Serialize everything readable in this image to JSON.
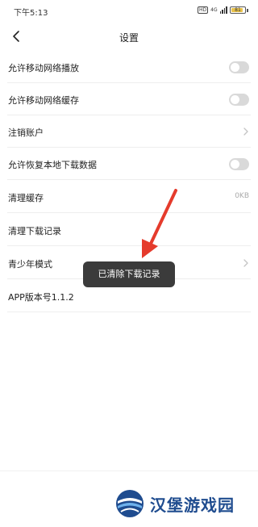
{
  "status_bar": {
    "time": "下午5:13",
    "hd": "HD",
    "network": "4G",
    "battery": "81",
    "battery_color": "#e9c24a"
  },
  "header": {
    "title": "设置",
    "back_icon": "chevron-left-icon"
  },
  "settings": {
    "allow_mobile_play": {
      "label": "允许移动网络播放",
      "enabled": false
    },
    "allow_mobile_cache": {
      "label": "允许移动网络缓存",
      "enabled": false
    },
    "cancel_account": {
      "label": "注销账户"
    },
    "allow_restore_local": {
      "label": "允许恢复本地下载数据",
      "enabled": false
    },
    "clear_cache": {
      "label": "清理缓存",
      "value": "0KB"
    },
    "clear_download_records": {
      "label": "清理下载记录"
    },
    "teen_mode": {
      "label": "青少年模式"
    },
    "app_version": {
      "label": "APP版本号1.1.2"
    }
  },
  "toast": {
    "text": "已清除下载记录"
  },
  "annotation": {
    "arrow_color": "#e53b2c"
  },
  "watermark": {
    "text": "汉堡游戏园",
    "color": "#1f4c8f"
  }
}
